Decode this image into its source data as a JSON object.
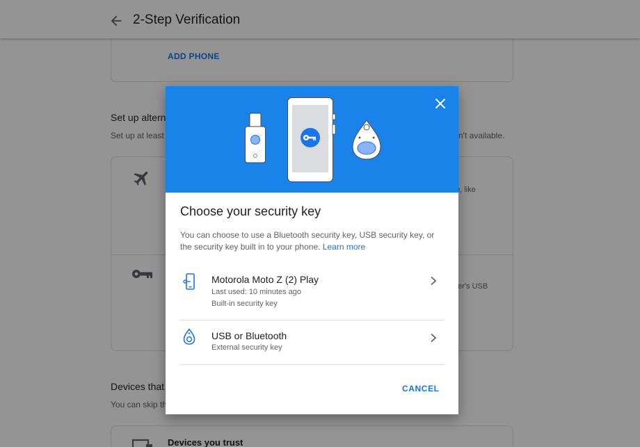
{
  "header": {
    "title": "2-Step Verification",
    "back_icon": "back-arrow-icon"
  },
  "phone_card": {
    "add_phone_label": "ADD PHONE"
  },
  "alternative_section": {
    "title": "Set up altern",
    "subtitle": "Set up at least",
    "subtitle_right": "n't available.",
    "option1_right": "ne, like",
    "option2_right": "uter's USB"
  },
  "devices_section": {
    "title": "Devices that",
    "subtitle": "You can skip th",
    "card_title": "Devices you trust"
  },
  "dialog": {
    "title": "Choose your security key",
    "description": "You can choose to use a Bluetooth security key, USB security key, or the security key built in to your phone.",
    "learn_more": "Learn more",
    "options": [
      {
        "icon": "phone-key-icon",
        "name": "Motorola Moto Z (2) Play",
        "line1": "Last used: 10 minutes ago",
        "line2": "Built-in security key"
      },
      {
        "icon": "bluetooth-key-icon",
        "name": "USB or Bluetooth",
        "line1": "External security key"
      }
    ],
    "cancel_label": "CANCEL"
  },
  "colors": {
    "accent": "#1a73e8",
    "hero_blue": "#1a83ea",
    "scrim": "rgba(0,0,0,0.42)"
  }
}
